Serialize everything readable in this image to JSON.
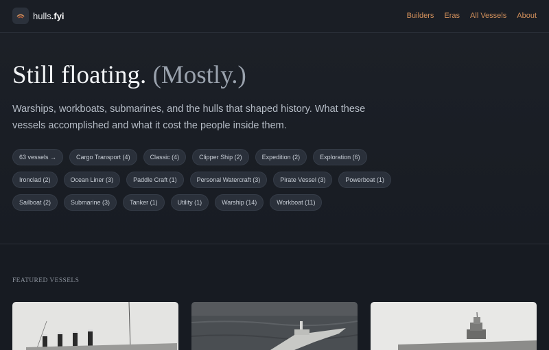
{
  "brand": {
    "prefix": "hulls",
    "suffix": ".fyi",
    "logo_icon": "ship-icon"
  },
  "nav": {
    "items": [
      {
        "label": "Builders"
      },
      {
        "label": "Eras"
      },
      {
        "label": "All Vessels"
      },
      {
        "label": "About"
      }
    ]
  },
  "hero": {
    "title": "Still floating.",
    "title_muted": "(Mostly.)",
    "subtitle": "Warships, workboats, submarines, and the hulls that shaped history. What these vessels accomplished and what it cost the people inside them."
  },
  "filters": {
    "rows": [
      [
        {
          "label": "63 vessels →"
        },
        {
          "label": "Cargo Transport (4)"
        },
        {
          "label": "Classic (4)"
        },
        {
          "label": "Clipper Ship (2)"
        },
        {
          "label": "Expedition (2)"
        },
        {
          "label": "Exploration (6)"
        }
      ],
      [
        {
          "label": "Ironclad (2)"
        },
        {
          "label": "Ocean Liner (3)"
        },
        {
          "label": "Paddle Craft (1)"
        },
        {
          "label": "Personal Watercraft (3)"
        },
        {
          "label": "Pirate Vessel (3)"
        },
        {
          "label": "Powerboat (1)"
        }
      ],
      [
        {
          "label": "Sailboat (2)"
        },
        {
          "label": "Submarine (3)"
        },
        {
          "label": "Tanker (1)"
        },
        {
          "label": "Utility (1)"
        },
        {
          "label": "Warship (14)"
        },
        {
          "label": "Workboat (11)"
        }
      ]
    ]
  },
  "featured": {
    "label": "FEATURED VESSELS"
  },
  "colors": {
    "background": "#171b22",
    "accent": "#d4915c",
    "chip_bg": "#2a303a",
    "title_muted": "#9aa2ad"
  }
}
